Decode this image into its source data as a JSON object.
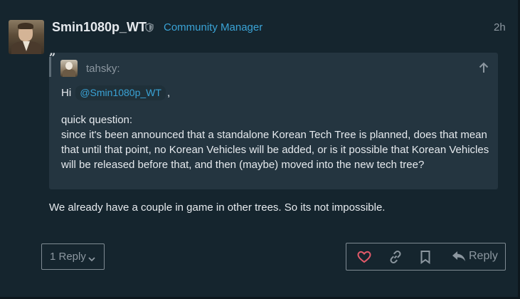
{
  "post": {
    "username": "Smin1080p_WT",
    "user_title": "Community Manager",
    "time_ago": "2h",
    "quote": {
      "mark": "”",
      "username": "tahsky:",
      "greeting": "Hi",
      "mention": "@Smin1080p_WT",
      "greeting_suffix": ",",
      "line1": "quick question:",
      "line2": "since it's been announced that a standalone Korean Tech Tree is planned, does that mean that until that point, no Korean Vehicles will be added, or is it possible that Korean Vehicles will be released before that, and then (maybe) moved into the new tech tree?"
    },
    "reply_text": "We already have a couple in game in other trees. So its not impossible.",
    "replies_label": "1 Reply",
    "reply_button_label": "Reply"
  },
  "icons": {
    "shield": "shield-icon",
    "quote_up": "arrow-up-icon",
    "like": "heart-icon",
    "link": "link-icon",
    "bookmark": "bookmark-icon",
    "reply": "reply-arrow-icon",
    "chevron": "chevron-down-icon"
  },
  "colors": {
    "background": "#15252e",
    "quote_background": "#243540",
    "accent": "#3aa3d6",
    "like": "#e45a6a",
    "muted": "#8c97a0"
  }
}
